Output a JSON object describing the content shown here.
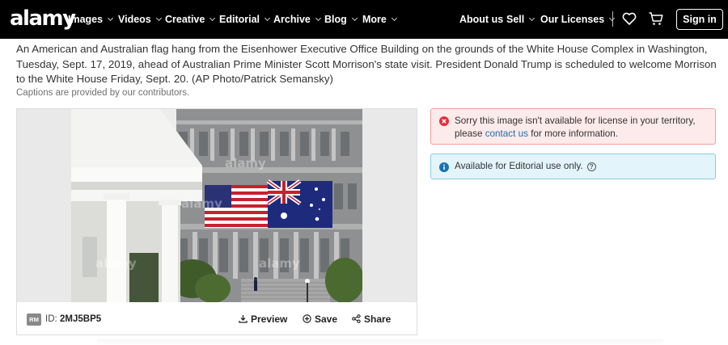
{
  "nav": {
    "logo": "alamy",
    "menu": [
      {
        "label": "Images"
      },
      {
        "label": "Videos"
      },
      {
        "label": "Creative"
      },
      {
        "label": "Editorial"
      },
      {
        "label": "Archive"
      },
      {
        "label": "Blog"
      },
      {
        "label": "More"
      }
    ],
    "about_label": "About us",
    "sell_label": "Sell",
    "licenses_label": "Our Licenses",
    "signin_label": "Sign in",
    "icons": [
      "heart-icon",
      "cart-icon"
    ]
  },
  "caption": {
    "text": "An American and Australian flag hang from the Eisenhower Executive Office Building on the grounds of the White House Complex in Washington, Tuesday, Sept. 17, 2019, ahead of Australian Prime Minister Scott Morrison's state visit. President Donald Trump is scheduled to welcome Morrison to the White House Friday, Sept. 20. (AP Photo/Patrick Semansky)",
    "note": "Captions are provided by our contributors."
  },
  "image": {
    "watermark": "alamy",
    "license_badge": "RM",
    "id_label": "ID:",
    "id_value": "2MJ5BP5",
    "actions": {
      "preview": "Preview",
      "save": "Save",
      "share": "Share"
    }
  },
  "alerts": {
    "error": {
      "line1": "Sorry this image isn't available for license in your territory,",
      "line2_pre": "please ",
      "line2_link": "contact us",
      "line2_post": " for more information."
    },
    "info": {
      "text": "Available for Editorial use only.",
      "help_glyph": "?"
    }
  },
  "colors": {
    "nav_bg": "#000000",
    "error_bg": "#fdeaea",
    "error_border": "#f0a0a0",
    "error_icon": "#e2303a",
    "info_bg": "#e4f4fb",
    "info_border": "#88cce8",
    "info_icon": "#1673b4",
    "link": "#1a6fb0"
  }
}
